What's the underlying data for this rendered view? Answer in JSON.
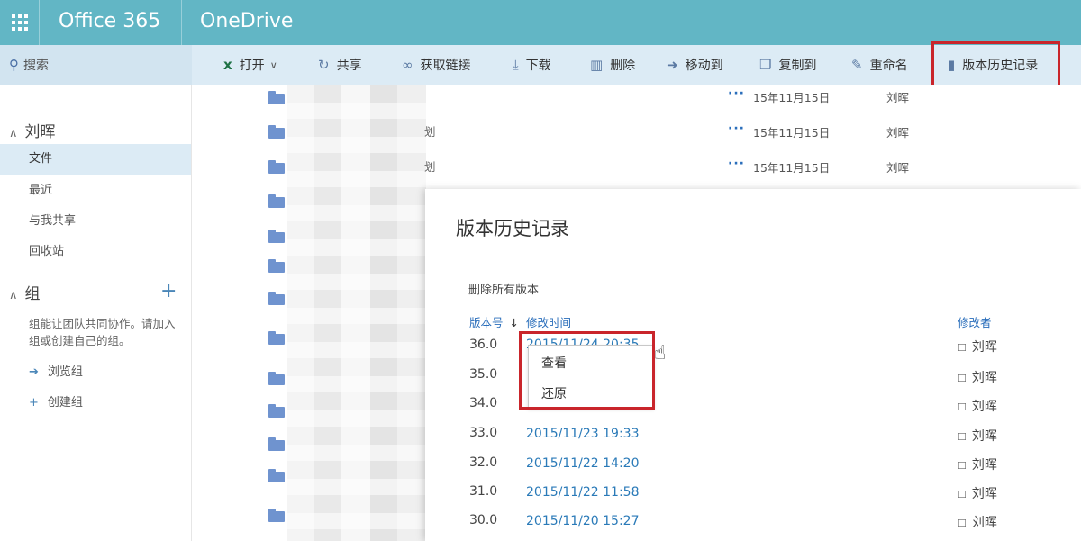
{
  "header": {
    "app_name": "Office 365",
    "app_section": "OneDrive"
  },
  "toolbar": {
    "search_label": "搜索",
    "open": "打开",
    "share": "共享",
    "get_link": "获取链接",
    "download": "下载",
    "delete": "删除",
    "move_to": "移动到",
    "copy_to": "复制到",
    "rename": "重命名",
    "version_history": "版本历史记录"
  },
  "sidebar": {
    "user_name": "刘晖",
    "items": [
      {
        "label": "文件"
      },
      {
        "label": "最近"
      },
      {
        "label": "与我共享"
      },
      {
        "label": "回收站"
      }
    ],
    "groups_title": "组",
    "groups_desc": "组能让团队共同协作。请加入组或创建自己的组。",
    "browse_groups": "浏览组",
    "create_group": "创建组"
  },
  "files": {
    "rows": [
      {
        "date": "15年11月15日",
        "owner": "刘晖",
        "name_fragment": ""
      },
      {
        "date": "15年11月15日",
        "owner": "刘晖",
        "name_fragment": "划"
      },
      {
        "date": "15年11月15日",
        "owner": "刘晖",
        "name_fragment": "划"
      }
    ]
  },
  "version_panel": {
    "title": "版本历史记录",
    "delete_all": "删除所有版本",
    "col_version": "版本号",
    "sort_arrow": "↓",
    "col_modified": "修改时间",
    "col_modifier": "修改者",
    "versions": [
      {
        "version": "36.0",
        "time": "2015/11/24 20:35",
        "modifier": "刘晖"
      },
      {
        "version": "35.0",
        "time": "",
        "modifier": "刘晖"
      },
      {
        "version": "34.0",
        "time": "",
        "modifier": "刘晖"
      },
      {
        "version": "33.0",
        "time": "2015/11/23 19:33",
        "modifier": "刘晖"
      },
      {
        "version": "32.0",
        "time": "2015/11/22 14:20",
        "modifier": "刘晖"
      },
      {
        "version": "31.0",
        "time": "2015/11/22 11:58",
        "modifier": "刘晖"
      },
      {
        "version": "30.0",
        "time": "2015/11/20 15:27",
        "modifier": "刘晖"
      }
    ],
    "context_menu": {
      "view": "查看",
      "restore": "还原"
    }
  },
  "colors": {
    "header_bg": "#62b6c5",
    "commandbar_bg": "#dcebf5",
    "highlight_box": "#c9252b",
    "link": "#2a7ab8"
  }
}
